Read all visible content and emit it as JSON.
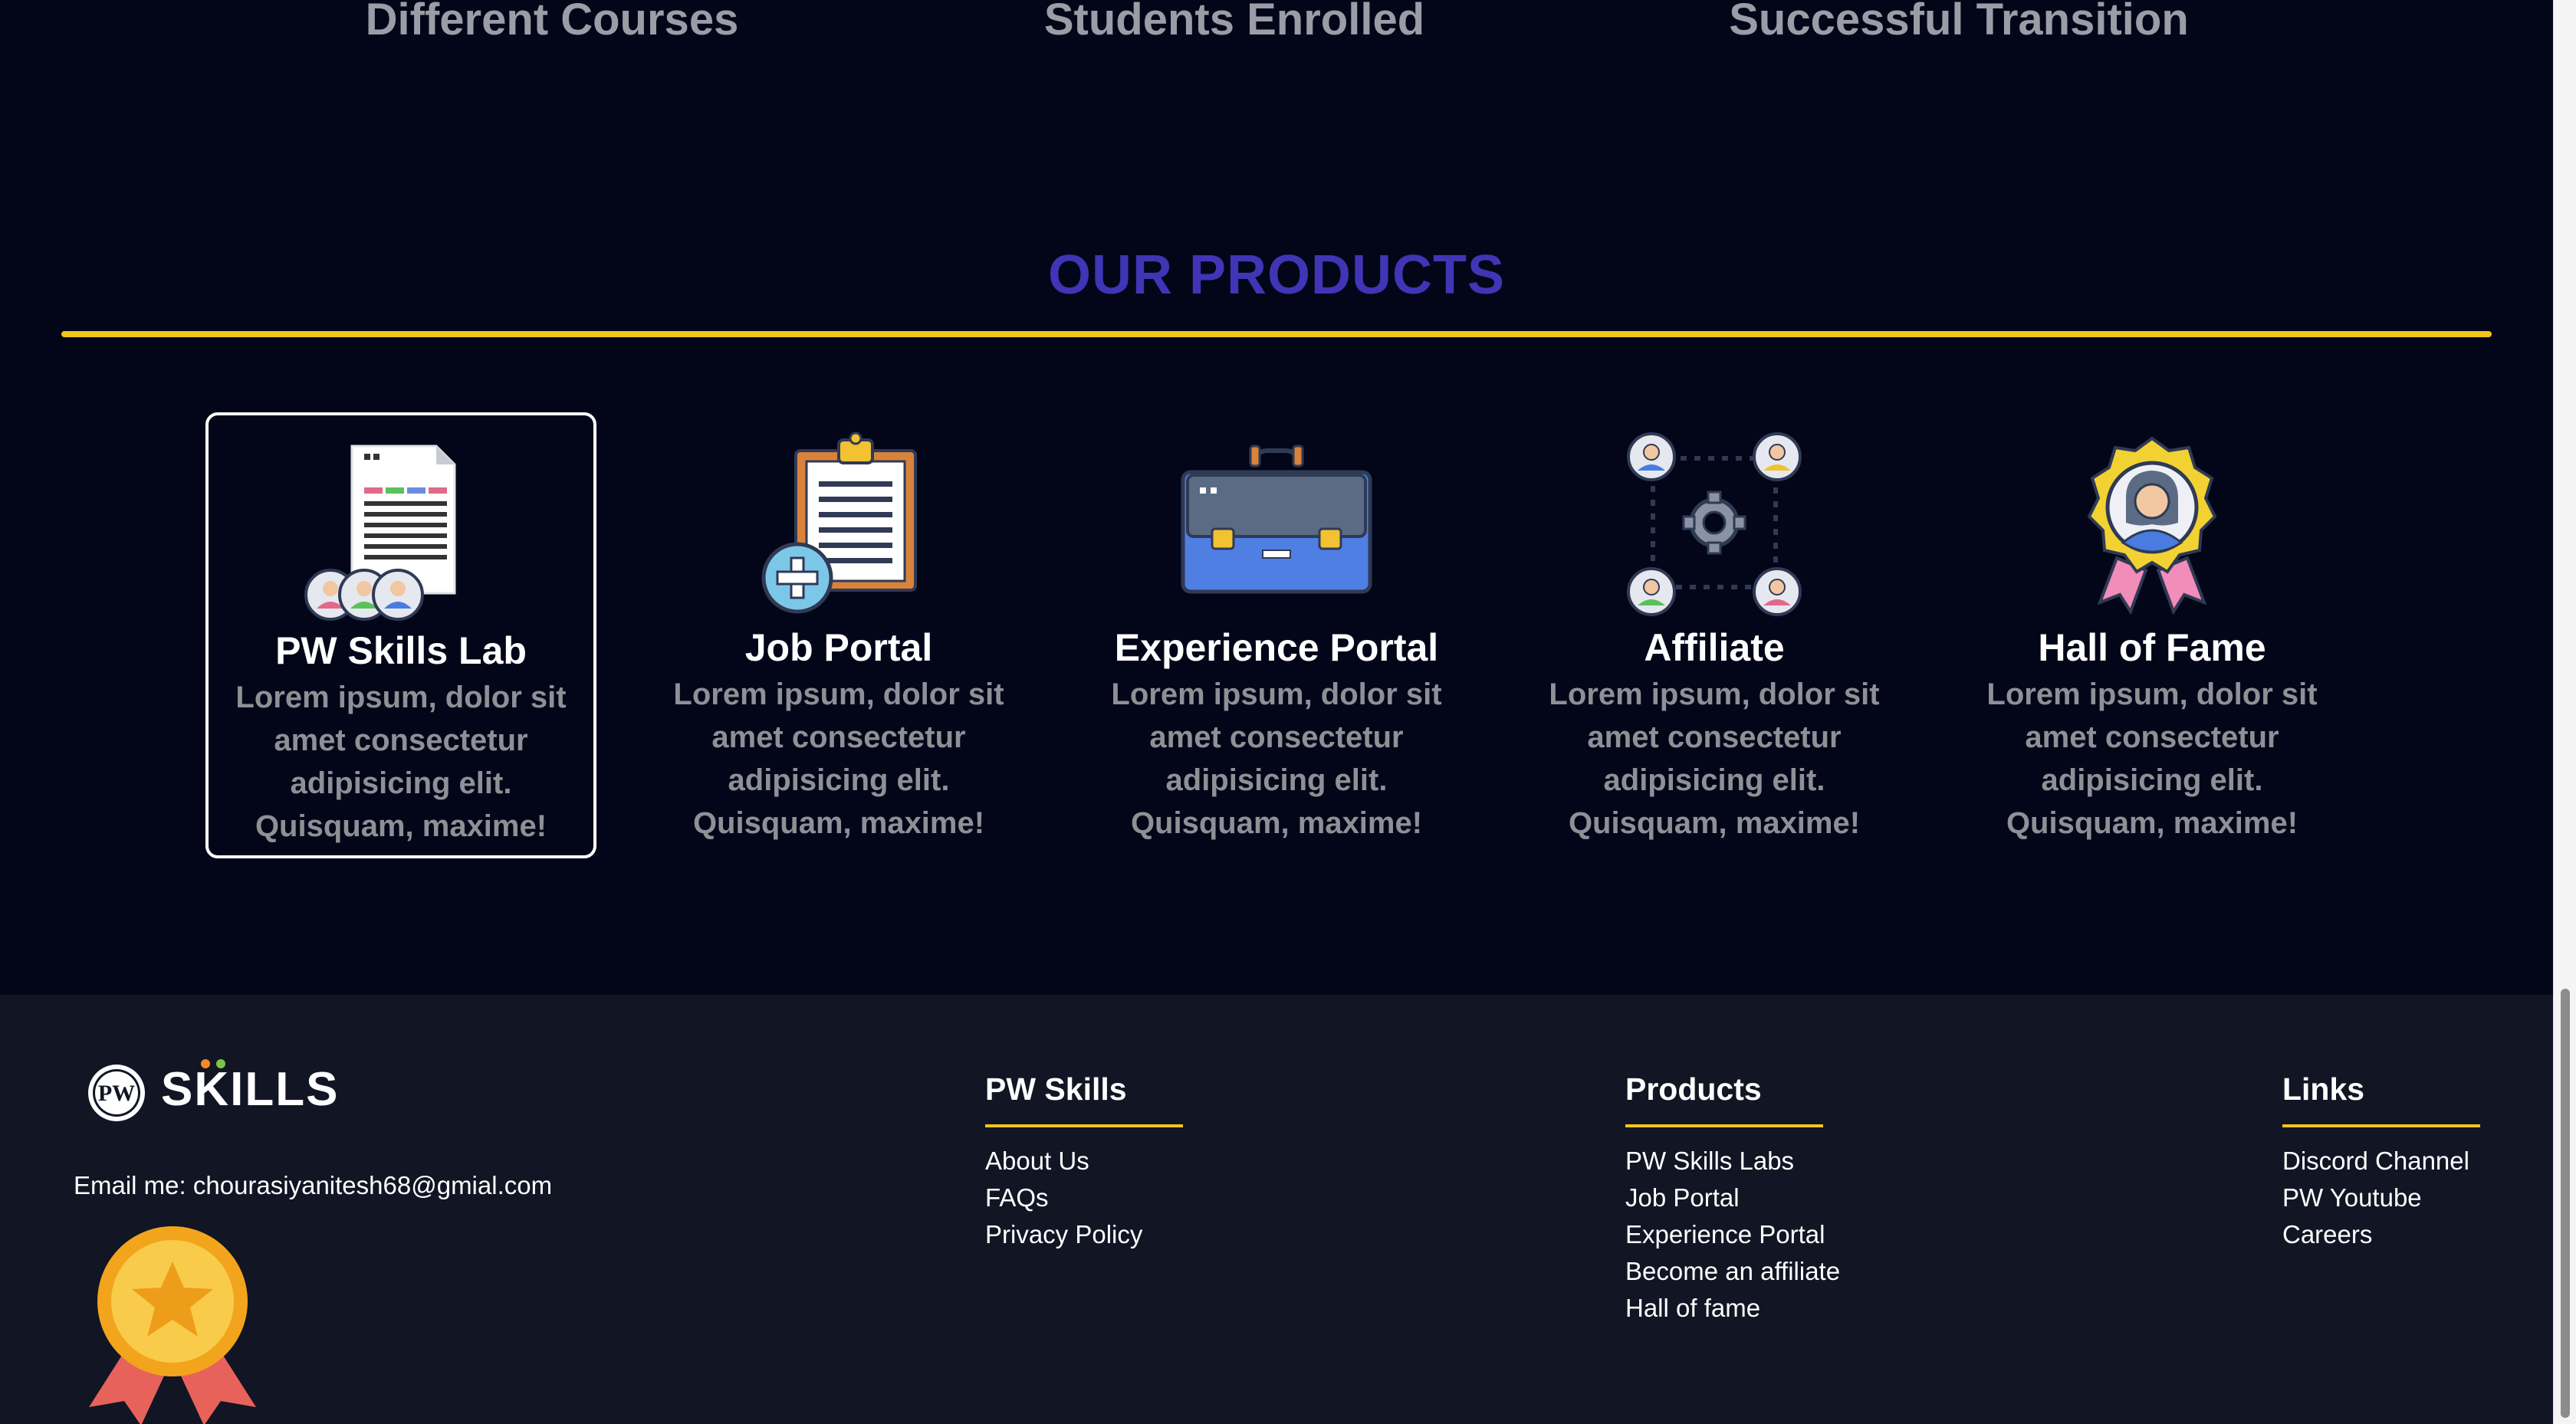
{
  "stats": {
    "items": [
      {
        "label": "Different Courses"
      },
      {
        "label": "Students Enrolled"
      },
      {
        "label": "Successful Transition"
      }
    ]
  },
  "products": {
    "title": "OUR PRODUCTS",
    "items": [
      {
        "name": "PW Skills Lab",
        "desc": "Lorem ipsum, dolor sit amet consectetur adipisicing elit. Quisquam, maxime!",
        "icon": "document-users-icon",
        "selected": true
      },
      {
        "name": "Job Portal",
        "desc": "Lorem ipsum, dolor sit amet consectetur adipisicing elit. Quisquam, maxime!",
        "icon": "clipboard-plus-icon",
        "selected": false
      },
      {
        "name": "Experience Portal",
        "desc": "Lorem ipsum, dolor sit amet consectetur adipisicing elit. Quisquam, maxime!",
        "icon": "briefcase-icon",
        "selected": false
      },
      {
        "name": "Affiliate",
        "desc": "Lorem ipsum, dolor sit amet consectetur adipisicing elit. Quisquam, maxime!",
        "icon": "network-gear-icon",
        "selected": false
      },
      {
        "name": "Hall of Fame",
        "desc": "Lorem ipsum, dolor sit amet consectetur adipisicing elit. Quisquam, maxime!",
        "icon": "award-badge-icon",
        "selected": false
      }
    ]
  },
  "footer": {
    "brand": "SKILLS",
    "logo_mark": "PW",
    "email": "Email me: chourasiyanitesh68@gmial.com",
    "columns": [
      {
        "heading": "PW Skills",
        "links": [
          "About Us",
          "FAQs",
          "Privacy Policy"
        ]
      },
      {
        "heading": "Products",
        "links": [
          "PW Skills Labs",
          "Job Portal",
          "Experience Portal",
          "Become an affiliate",
          "Hall of fame"
        ]
      },
      {
        "heading": "Links",
        "links": [
          "Discord Channel",
          "PW Youtube",
          "Careers"
        ]
      }
    ]
  },
  "colors": {
    "background": "#030618",
    "footer_bg": "#111524",
    "accent_yellow": "#f3c51b",
    "title_purple": "#3f35b5",
    "muted_text": "#8f9096"
  }
}
